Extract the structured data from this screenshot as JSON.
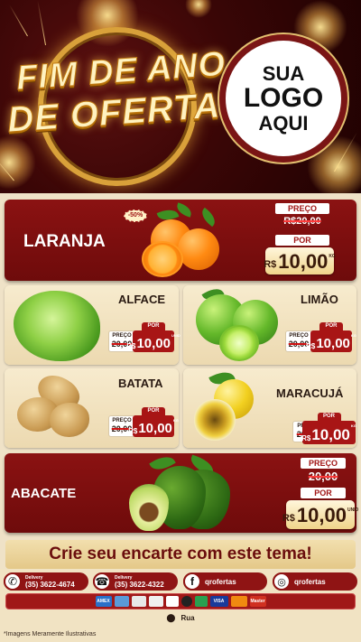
{
  "header": {
    "title_line1": "FIM DE ANO",
    "title_line2": "DE OFERTAS",
    "logo_line1": "SUA",
    "logo_line2": "LOGO",
    "logo_line3": "AQUI"
  },
  "products": {
    "laranja": {
      "name": "LARANJA",
      "discount": "-50%",
      "old_label": "PREÇO",
      "old_price": "R$20,00",
      "new_label": "POR",
      "currency": "R$",
      "price": "10,00",
      "unit": "KG"
    },
    "alface": {
      "name": "ALFACE",
      "old_label": "PREÇO",
      "old_price": "20,00",
      "new_label": "POR",
      "currency": "R$",
      "price": "10,00",
      "unit": "UNID"
    },
    "limao": {
      "name": "LIMÃO",
      "old_label": "PREÇO",
      "old_price": "20,00",
      "new_label": "POR",
      "currency": "R$",
      "price": "10,00",
      "unit": "KG"
    },
    "batata": {
      "name": "BATATA",
      "old_label": "PREÇO",
      "old_price": "20,00",
      "new_label": "POR",
      "currency": "R$",
      "price": "10,00",
      "unit": "KG"
    },
    "maracuja": {
      "name": "MARACUJÁ",
      "old_label": "PREÇO",
      "old_price": "20,00",
      "new_label": "POR",
      "currency": "R$",
      "price": "10,00",
      "unit": "KG"
    },
    "abacate": {
      "name": "ABACATE",
      "old_label": "PREÇO",
      "old_price": "20,00",
      "new_label": "POR",
      "currency": "R$",
      "price": "10,00",
      "unit": "UNID"
    }
  },
  "cta": "Crie seu encarte com este tema!",
  "contacts": {
    "whatsapp": {
      "label": "Delivery",
      "number": "(35) 3622-4674",
      "icon": "whatsapp-icon"
    },
    "phone": {
      "label": "Delivery",
      "number": "(35) 3622-4322",
      "icon": "phone-icon"
    },
    "facebook": {
      "handle": "qrofertas",
      "icon": "facebook-icon"
    },
    "instagram": {
      "handle": "qrofertas",
      "icon": "instagram-icon"
    }
  },
  "payments": [
    "AMEX",
    "VISA",
    "Master"
  ],
  "address": "Rua",
  "disclaimer": "*Imagens Meramente Ilustrativas",
  "colors": {
    "brand_red": "#8b1212",
    "cream": "#f7ebce",
    "gold": "#d9a13a"
  }
}
